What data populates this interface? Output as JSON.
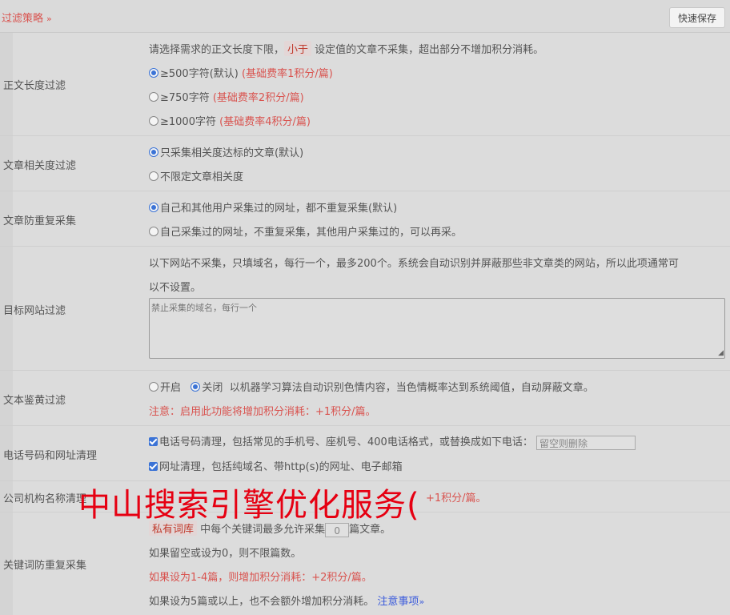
{
  "header": {
    "title": "过滤策略",
    "chevron": "»",
    "quick_save": "快速保存"
  },
  "length_filter": {
    "label": "正文长度过滤",
    "desc_a": "请选择需求的正文长度下限，",
    "desc_tag": "小于",
    "desc_b": "设定值的文章不采集，超出部分不增加积分消耗。",
    "options": [
      {
        "text": "≥500字符(默认)",
        "note": "(基础费率1积分/篇)",
        "checked": true
      },
      {
        "text": "≥750字符",
        "note": "(基础费率2积分/篇)",
        "checked": false
      },
      {
        "text": "≥1000字符",
        "note": "(基础费率4积分/篇)",
        "checked": false
      }
    ]
  },
  "relevance_filter": {
    "label": "文章相关度过滤",
    "options": [
      {
        "text": "只采集相关度达标的文章(默认)",
        "checked": true
      },
      {
        "text": "不限定文章相关度",
        "checked": false
      }
    ]
  },
  "dedupe": {
    "label": "文章防重复采集",
    "options": [
      {
        "text": "自己和其他用户采集过的网址，都不重复采集(默认)",
        "checked": true
      },
      {
        "text": "自己采集过的网址，不重复采集，其他用户采集过的，可以再采。",
        "checked": false
      }
    ]
  },
  "site_filter": {
    "label": "目标网站过滤",
    "desc_line1": "以下网站不采集，只填域名，每行一个，最多200个。系统会自动识别并屏蔽那些非文章类的网站，所以此项通常可",
    "desc_line2": "以不设置。",
    "placeholder": "禁止采集的域名，每行一个"
  },
  "porn_filter": {
    "label": "文本鉴黄过滤",
    "on_label": "开启",
    "off_label": "关闭",
    "on_checked": false,
    "off_checked": true,
    "desc": "以机器学习算法自动识别色情内容，当色情概率达到系统阈值，自动屏蔽文章。",
    "warning": "注意：启用此功能将增加积分消耗：+1积分/篇。"
  },
  "cleanup": {
    "label": "电话号码和网址清理",
    "phone_text": "电话号码清理，包括常见的手机号、座机号、400电话格式，或替换成如下电话：",
    "phone_placeholder": "留空则删除",
    "url_text": "网址清理，包括纯域名、带http(s)的网址、电子邮箱"
  },
  "org_clean": {
    "label": "公司机构名称清理",
    "visible_tail": "+1积分/篇。"
  },
  "keyword_dedupe": {
    "label": "关键词防重复采集",
    "tag": "私有词库",
    "text_a": "中每个关键词最多允许采集",
    "value": "0",
    "text_b": "篇文章。",
    "line2": "如果留空或设为0，则不限篇数。",
    "line3": "如果设为1-4篇，则增加积分消耗：+2积分/篇。",
    "line4": "如果设为5篇或以上，也不会额外增加积分消耗。",
    "link": "注意事项",
    "link_chevron": "»"
  },
  "overlay": {
    "watermark": "中山搜索引擎优化服务("
  }
}
